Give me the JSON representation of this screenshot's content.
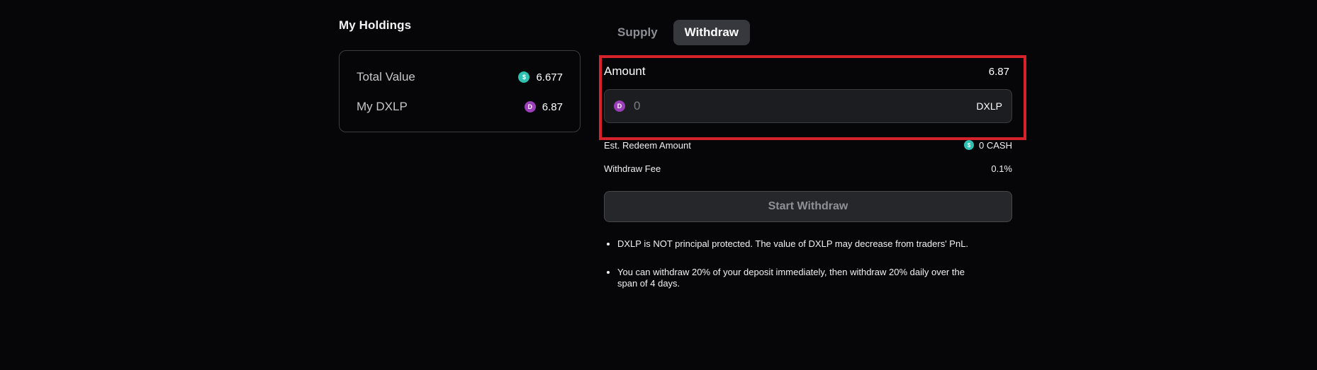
{
  "holdings": {
    "title": "My Holdings",
    "rows": [
      {
        "label": "Total Value",
        "icon": "cash-coin-icon",
        "value": "6.677"
      },
      {
        "label": "My DXLP",
        "icon": "dxlp-coin-icon",
        "value": "6.87"
      }
    ]
  },
  "tabs": [
    {
      "label": "Supply",
      "active": false
    },
    {
      "label": "Withdraw",
      "active": true
    }
  ],
  "amount": {
    "label": "Amount",
    "max": "6.87",
    "placeholder": "0",
    "unit": "DXLP",
    "icon": "dxlp-coin-icon"
  },
  "info": {
    "est_label": "Est. Redeem Amount",
    "est_value": "0 CASH",
    "fee_label": "Withdraw Fee",
    "fee_value": "0.1%"
  },
  "button": {
    "label": "Start Withdraw"
  },
  "notes": [
    "DXLP is NOT principal protected. The value of DXLP may decrease from traders' PnL.",
    "You can withdraw 20% of your deposit immediately, then withdraw 20% daily over the span of 4 days."
  ],
  "colors": {
    "background": "#060608",
    "highlight": "#d6222b",
    "cash_coin": "#2fc0b2",
    "dxlp_coin": "#9a3fb8",
    "active_tab": "#37383d"
  }
}
